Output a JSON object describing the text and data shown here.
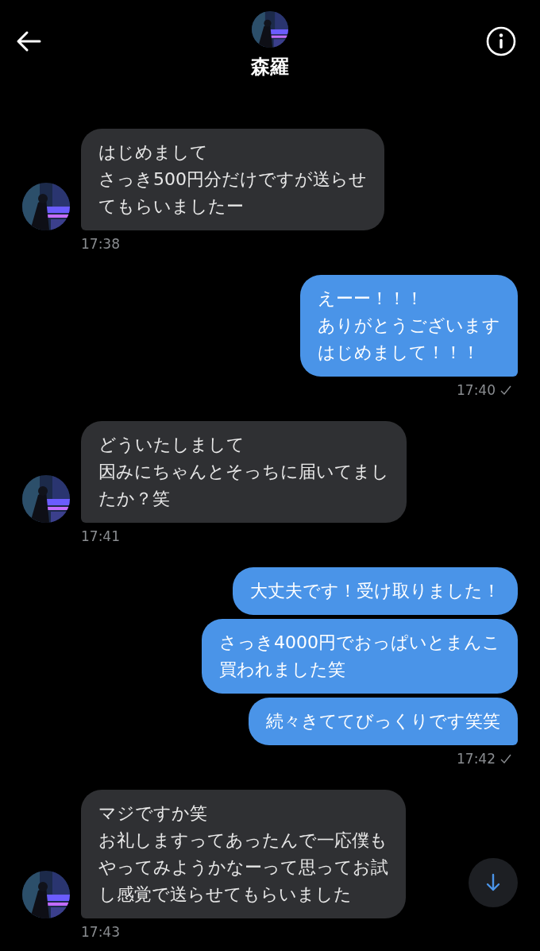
{
  "header": {
    "name": "森羅"
  },
  "messages": [
    {
      "kind": "incoming",
      "bubbles": [
        {
          "lines": [
            "はじめまして",
            "さっき500円分だけですが送らせ",
            "てもらいましたー"
          ]
        }
      ],
      "time": "17:38"
    },
    {
      "kind": "outgoing",
      "bubbles": [
        {
          "lines": [
            "えーー！！！",
            "ありがとうございます",
            "はじめまして！！！"
          ]
        }
      ],
      "time": "17:40",
      "read": true
    },
    {
      "kind": "incoming",
      "bubbles": [
        {
          "lines": [
            "どういたしまして",
            "因みにちゃんとそっちに届いてまし",
            "たか？笑"
          ]
        }
      ],
      "time": "17:41"
    },
    {
      "kind": "outgoing",
      "bubbles": [
        {
          "lines": [
            "大丈夫です！受け取りました！"
          ]
        },
        {
          "lines": [
            "さっき4000円でおっぱいとまんこ",
            "買われました笑"
          ]
        },
        {
          "lines": [
            "続々きててびっくりです笑笑"
          ]
        }
      ],
      "time": "17:42",
      "read": true
    },
    {
      "kind": "incoming",
      "bubbles": [
        {
          "lines": [
            "マジですか笑",
            "お礼しますってあったんで一応僕も",
            "やってみようかなーって思ってお試",
            "し感覚で送らせてもらいました"
          ]
        }
      ],
      "time": "17:43"
    }
  ]
}
